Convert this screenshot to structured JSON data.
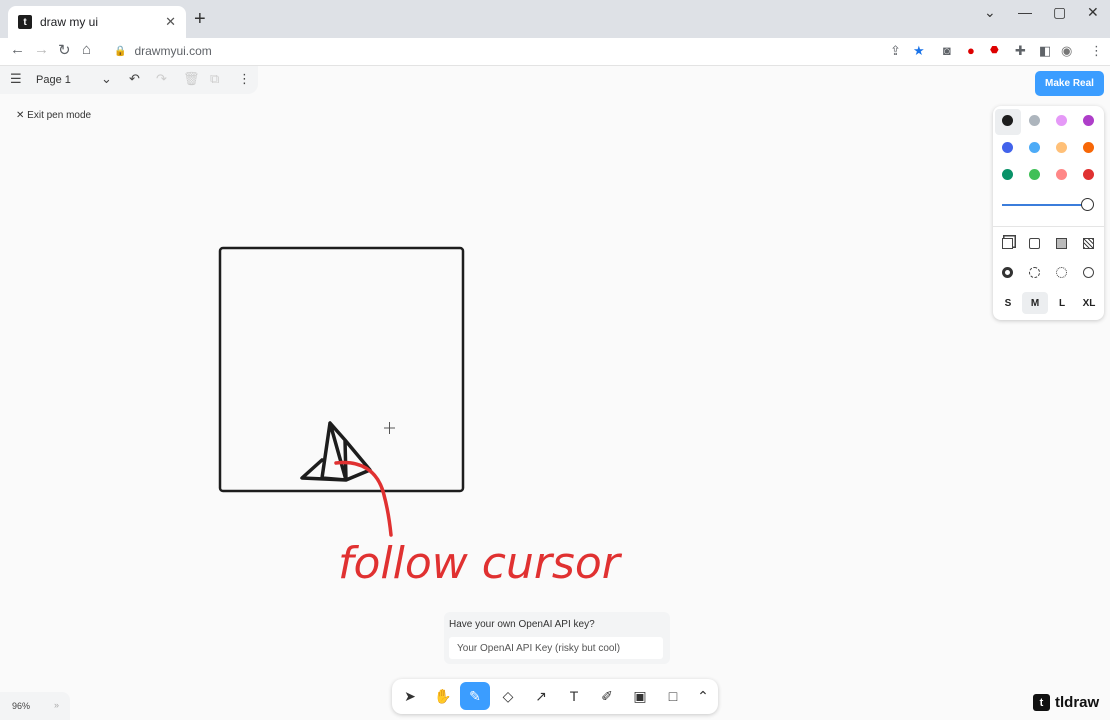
{
  "browser": {
    "tab_title": "draw my ui",
    "url": "drawmyui.com",
    "new_tab_symbol": "+",
    "tab_close_symbol": "✕"
  },
  "app": {
    "page_name": "Page 1",
    "exit_pen_mode": "Exit pen mode",
    "make_real_label": "Make Real",
    "api_prompt": "Have your own OpenAI API key?",
    "api_placeholder": "Your OpenAI API Key (risky but cool)",
    "zoom_level": "96%",
    "brand_name": "tldraw",
    "annotation_text": "follow cursor"
  },
  "style_panel": {
    "colors": [
      "#1d1d1d",
      "#adb5bd",
      "#e599f7",
      "#ae3ec9",
      "#4263eb",
      "#4dabf7",
      "#ffc078",
      "#f76707",
      "#099268",
      "#40c057",
      "#ff8787",
      "#e03131"
    ],
    "selected_color": "#1d1d1d",
    "opacity": 1.0,
    "sizes": [
      "S",
      "M",
      "L",
      "XL"
    ],
    "selected_size": "M"
  },
  "tools": {
    "items": [
      "select",
      "hand",
      "draw",
      "eraser",
      "arrow",
      "text",
      "note",
      "image",
      "rectangle",
      "more"
    ],
    "active": "draw"
  },
  "colors": {
    "accent": "#3b9dff",
    "drawing_red": "#e03131",
    "drawing_black": "#1d1d1d"
  }
}
